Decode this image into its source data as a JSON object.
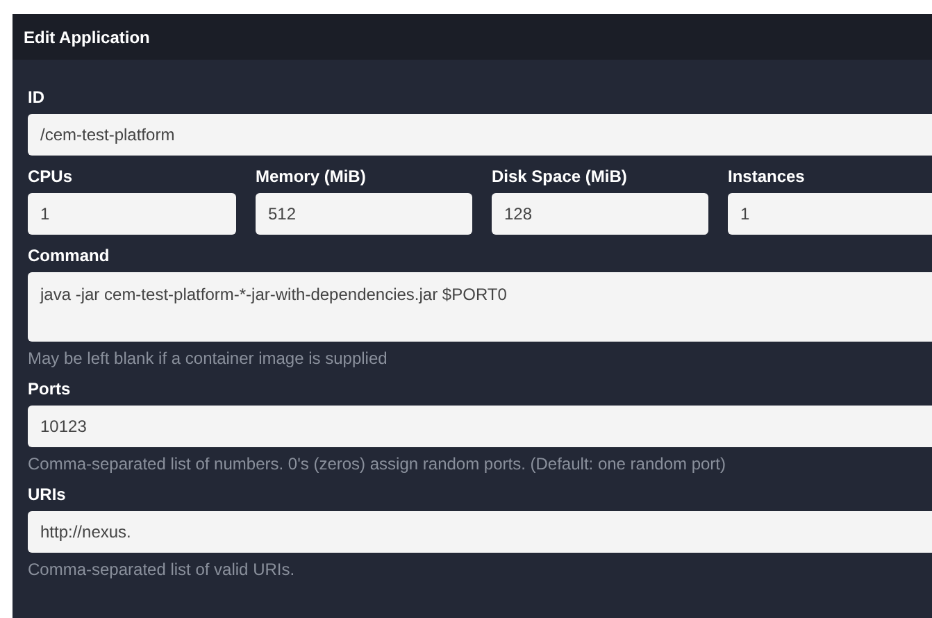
{
  "dialog": {
    "title": "Edit Application"
  },
  "id_field": {
    "label": "ID",
    "value": "/cem-test-platform"
  },
  "resources": [
    {
      "label": "CPUs",
      "value": "1"
    },
    {
      "label": "Memory (MiB)",
      "value": "512"
    },
    {
      "label": "Disk Space (MiB)",
      "value": "128"
    },
    {
      "label": "Instances",
      "value": "1"
    }
  ],
  "command": {
    "label": "Command",
    "value": "java -jar cem-test-platform-*-jar-with-dependencies.jar $PORT0",
    "help": "May be left blank if a container image is supplied"
  },
  "ports": {
    "label": "Ports",
    "value": "10123",
    "help": "Comma-separated list of numbers. 0's (zeros) assign random ports. (Default: one random port)"
  },
  "uris": {
    "label": "URIs",
    "value": "http://nexus.",
    "help": "Comma-separated list of valid URIs."
  }
}
